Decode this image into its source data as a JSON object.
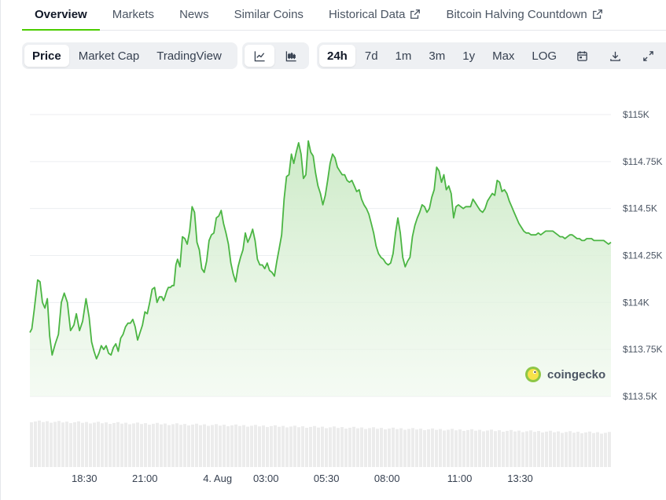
{
  "tabs": [
    {
      "label": "Overview",
      "active": true,
      "external": false
    },
    {
      "label": "Markets",
      "active": false,
      "external": false
    },
    {
      "label": "News",
      "active": false,
      "external": false
    },
    {
      "label": "Similar Coins",
      "active": false,
      "external": false
    },
    {
      "label": "Historical Data",
      "active": false,
      "external": true
    },
    {
      "label": "Bitcoin Halving Countdown",
      "active": false,
      "external": true
    }
  ],
  "toolbar": {
    "view_buttons": [
      "Price",
      "Market Cap",
      "TradingView"
    ],
    "active_view": "Price",
    "chart_style_icons": [
      "line-chart-icon",
      "candlestick-chart-icon"
    ],
    "active_style": "line-chart-icon",
    "ranges": [
      "24h",
      "7d",
      "1m",
      "3m",
      "1y",
      "Max",
      "LOG"
    ],
    "active_range": "24h",
    "action_icons": [
      "calendar-icon",
      "download-icon",
      "fullscreen-icon"
    ]
  },
  "watermark": "coingecko",
  "colors": {
    "line": "#4bb543",
    "area_top": "#cdebc8",
    "volume": "#ececec",
    "accent": "#4bcc00"
  },
  "chart_data": {
    "type": "area",
    "title": "",
    "xlabel": "",
    "ylabel": "",
    "ylim": [
      113500,
      115000
    ],
    "yticks": [
      115000,
      114750,
      114500,
      114250,
      114000,
      113750,
      113500
    ],
    "ytick_labels": [
      "$115K",
      "$114.75K",
      "$114.5K",
      "$114.25K",
      "$114K",
      "$113.75K",
      "$113.5K"
    ],
    "xtick_labels": [
      "18:30",
      "21:00",
      "4. Aug",
      "03:00",
      "05:30",
      "08:00",
      "11:00",
      "13:30"
    ],
    "xtick_hours": [
      2.25,
      4.75,
      7.75,
      9.75,
      12.25,
      14.75,
      17.75,
      20.25
    ],
    "grid": true,
    "series": [
      {
        "x_hours": [
          0,
          0.08,
          0.18,
          0.32,
          0.42,
          0.52,
          0.62,
          0.72,
          0.82,
          0.92,
          1.05,
          1.18,
          1.3,
          1.42,
          1.55,
          1.68,
          1.82,
          1.92,
          2.05,
          2.18,
          2.32,
          2.45,
          2.55,
          2.65,
          2.75,
          2.85,
          2.95,
          3.05,
          3.15,
          3.25,
          3.35,
          3.45,
          3.55,
          3.65,
          3.75,
          3.85,
          3.95,
          4.05,
          4.15,
          4.25,
          4.35,
          4.45,
          4.55,
          4.65,
          4.75,
          4.85,
          4.95,
          5.05,
          5.15,
          5.25,
          5.35,
          5.45,
          5.52,
          5.58,
          5.65,
          5.72,
          5.8,
          5.88,
          5.95,
          6.03,
          6.1,
          6.2,
          6.3,
          6.4,
          6.5,
          6.6,
          6.7,
          6.8,
          6.9,
          7.0,
          7.1,
          7.2,
          7.3,
          7.4,
          7.5,
          7.6,
          7.7,
          7.8,
          7.9,
          8.0,
          8.1,
          8.2,
          8.3,
          8.4,
          8.5,
          8.6,
          8.7,
          8.8,
          8.9,
          9.0,
          9.1,
          9.2,
          9.3,
          9.4,
          9.5,
          9.6,
          9.7,
          9.8,
          9.9,
          10.0,
          10.1,
          10.2,
          10.3,
          10.4,
          10.5,
          10.6,
          10.7,
          10.8,
          10.9,
          11.0,
          11.1,
          11.2,
          11.3,
          11.4,
          11.5,
          11.6,
          11.7,
          11.8,
          11.9,
          12.0,
          12.1,
          12.2,
          12.3,
          12.4,
          12.5,
          12.6,
          12.7,
          12.8,
          12.9,
          13.0,
          13.1,
          13.2,
          13.3,
          13.4,
          13.5,
          13.6,
          13.7,
          13.8,
          13.9,
          14.0,
          14.1,
          14.2,
          14.3,
          14.4,
          14.5,
          14.6,
          14.7,
          14.8,
          14.9,
          15.0,
          15.1,
          15.2,
          15.3,
          15.4,
          15.5,
          15.6,
          15.7,
          15.8,
          15.9,
          16.0,
          16.1,
          16.2,
          16.3,
          16.4,
          16.5,
          16.6,
          16.7,
          16.8,
          16.9,
          17.0,
          17.1,
          17.2,
          17.3,
          17.4,
          17.5,
          17.6,
          17.7,
          17.8,
          17.9,
          18.0,
          18.1,
          18.2,
          18.3,
          18.4,
          18.5,
          18.6,
          18.7,
          18.8,
          18.9,
          19.0,
          19.1,
          19.2,
          19.3,
          19.4,
          19.5,
          19.6,
          19.7,
          19.8,
          19.9,
          20.0,
          20.1,
          20.2,
          20.3,
          20.4,
          20.5,
          20.6,
          20.7,
          20.8,
          20.9,
          21.0,
          21.1,
          21.2,
          21.3,
          21.4,
          21.5,
          21.6,
          21.7,
          21.8,
          21.9,
          22.0,
          22.1,
          22.2,
          22.3,
          22.4,
          22.5,
          22.6,
          22.7,
          22.8,
          22.9,
          23.0,
          23.1,
          23.2,
          23.3,
          23.4,
          23.5,
          23.6,
          23.7,
          23.8,
          23.9,
          24.0
        ],
        "values": [
          113840,
          113860,
          113960,
          114120,
          114110,
          114000,
          113970,
          114020,
          113820,
          113720,
          113780,
          113830,
          114000,
          114050,
          114000,
          113850,
          113880,
          113940,
          113850,
          113900,
          114020,
          113920,
          113790,
          113740,
          113700,
          113730,
          113770,
          113750,
          113770,
          113730,
          113720,
          113760,
          113780,
          113740,
          113810,
          113830,
          113870,
          113890,
          113890,
          113910,
          113870,
          113800,
          113840,
          113880,
          113950,
          113940,
          114000,
          114070,
          114080,
          114000,
          114030,
          114030,
          114010,
          114030,
          114060,
          114080,
          114080,
          114090,
          114090,
          114200,
          114230,
          114190,
          114350,
          114340,
          114310,
          114380,
          114510,
          114480,
          114320,
          114280,
          114180,
          114160,
          114220,
          114330,
          114360,
          114370,
          114450,
          114460,
          114490,
          114420,
          114370,
          114310,
          114210,
          114150,
          114110,
          114190,
          114240,
          114280,
          114370,
          114320,
          114350,
          114390,
          114330,
          114230,
          114200,
          114200,
          114180,
          114210,
          114170,
          114160,
          114140,
          114220,
          114290,
          114360,
          114550,
          114670,
          114680,
          114790,
          114740,
          114800,
          114850,
          114790,
          114660,
          114680,
          114860,
          114800,
          114780,
          114690,
          114620,
          114580,
          114520,
          114570,
          114650,
          114740,
          114790,
          114770,
          114720,
          114700,
          114680,
          114680,
          114650,
          114640,
          114650,
          114620,
          114590,
          114600,
          114550,
          114520,
          114500,
          114470,
          114420,
          114370,
          114300,
          114260,
          114240,
          114230,
          114210,
          114200,
          114210,
          114260,
          114370,
          114450,
          114370,
          114240,
          114190,
          114220,
          114240,
          114350,
          114410,
          114450,
          114480,
          114520,
          114510,
          114480,
          114500,
          114560,
          114600,
          114720,
          114700,
          114640,
          114680,
          114600,
          114620,
          114580,
          114450,
          114510,
          114520,
          114510,
          114500,
          114510,
          114510,
          114510,
          114550,
          114530,
          114510,
          114490,
          114480,
          114500,
          114540,
          114560,
          114580,
          114570,
          114650,
          114640,
          114590,
          114600,
          114580,
          114540,
          114510,
          114480,
          114450,
          114420,
          114400,
          114380,
          114370,
          114370,
          114360,
          114360,
          114360,
          114370,
          114360,
          114370,
          114380,
          114380,
          114380,
          114380,
          114370,
          114360,
          114350,
          114350,
          114340,
          114350,
          114360,
          114360,
          114350,
          114340,
          114340,
          114330,
          114330,
          114340,
          114340,
          114340,
          114330,
          114330,
          114330,
          114330,
          114330,
          114320,
          114310,
          114320
        ]
      }
    ]
  }
}
